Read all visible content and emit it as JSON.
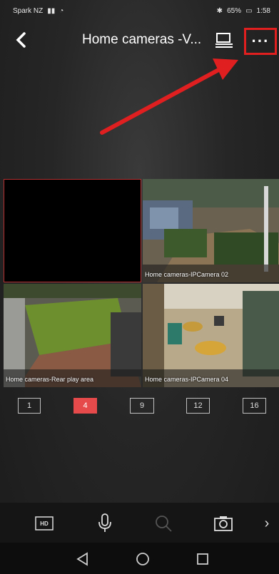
{
  "status_bar": {
    "carrier": "Spark NZ",
    "battery": "65%",
    "time": "1:58"
  },
  "nav": {
    "title": "Home cameras -V...",
    "more_label": "···"
  },
  "cameras": [
    {
      "label": ""
    },
    {
      "label": "Home cameras-IPCamera 02"
    },
    {
      "label": "Home cameras-Rear play area"
    },
    {
      "label": "Home cameras-IPCamera 04"
    }
  ],
  "layout_options": [
    "1",
    "4",
    "9",
    "12",
    "16"
  ],
  "selected_layout": "4",
  "toolbar": {
    "hd_label": "HD",
    "next_label": "›"
  },
  "colors": {
    "accent": "#e64a4a",
    "highlight_box": "#e21f1f"
  }
}
